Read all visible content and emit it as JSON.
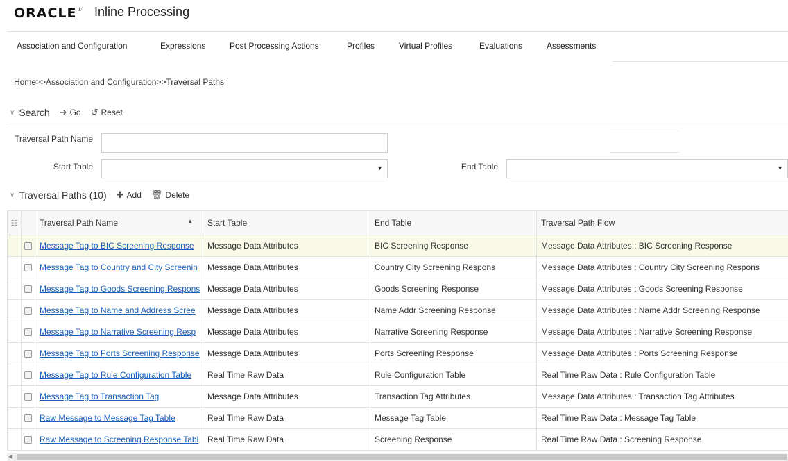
{
  "header": {
    "brand": "ORACLE",
    "brand_mark": "®",
    "app_title": "Inline Processing"
  },
  "tabs": [
    {
      "label": "Association and Configuration"
    },
    {
      "label": "Expressions"
    },
    {
      "label": "Post Processing Actions"
    },
    {
      "label": "Profiles"
    },
    {
      "label": "Virtual Profiles"
    },
    {
      "label": "Evaluations"
    },
    {
      "label": "Assessments"
    }
  ],
  "breadcrumb": "Home>>Association and Configuration>>Traversal Paths",
  "search": {
    "title": "Search",
    "go_label": "Go",
    "reset_label": "Reset",
    "fields": {
      "traversal_path_name_label": "Traversal Path Name",
      "traversal_path_name_value": "",
      "start_table_label": "Start Table",
      "start_table_value": "",
      "end_table_label": "End Table",
      "end_table_value": ""
    }
  },
  "grid": {
    "title": "Traversal Paths",
    "count": "(10)",
    "add_label": "Add",
    "delete_label": "Delete",
    "columns": [
      "Traversal Path Name",
      "Start Table",
      "End Table",
      "Traversal Path Flow"
    ],
    "rows": [
      [
        "Message Tag to BIC Screening Response",
        "Message Data Attributes",
        "BIC Screening Response",
        "Message Data Attributes : BIC Screening Response"
      ],
      [
        "Message Tag to Country and City Screenin",
        "Message Data Attributes",
        "Country City Screening Respons",
        "Message Data Attributes : Country City Screening Respons"
      ],
      [
        "Message Tag to Goods Screening Respons",
        "Message Data Attributes",
        "Goods Screening Response",
        "Message Data Attributes : Goods Screening Response"
      ],
      [
        "Message Tag to Name and Address Scree",
        "Message Data Attributes",
        "Name Addr Screening Response",
        "Message Data Attributes : Name Addr Screening Response"
      ],
      [
        "Message Tag to Narrative Screening Resp",
        "Message Data Attributes",
        "Narrative Screening Response",
        "Message Data Attributes : Narrative Screening Response"
      ],
      [
        "Message Tag to Ports Screening Response",
        "Message Data Attributes",
        "Ports Screening Response",
        "Message Data Attributes : Ports Screening Response"
      ],
      [
        "Message Tag to Rule Configuration Table",
        "Real Time Raw Data",
        "Rule Configuration Table",
        "Real Time Raw Data : Rule Configuration Table"
      ],
      [
        "Message Tag to Transaction Tag",
        "Message Data Attributes",
        "Transaction Tag Attributes",
        "Message Data Attributes : Transaction Tag Attributes"
      ],
      [
        "Raw Message to Message Tag Table",
        "Real Time Raw Data",
        "Message Tag Table",
        "Real Time Raw Data : Message Tag Table"
      ],
      [
        "Raw Message to Screening Response Tabl",
        "Real Time Raw Data",
        "Screening Response",
        "Real Time Raw Data : Screening Response"
      ]
    ]
  },
  "icons": {
    "collapse": "chevron-down-icon",
    "go": "arrow-right-icon",
    "reset": "refresh-icon",
    "add": "plus-icon",
    "delete": "trash-icon",
    "sort": "sort-asc-icon",
    "hierarchy": "hierarchy-icon",
    "dropdown": "caret-down-icon"
  },
  "colors": {
    "link": "#1a60b8",
    "selected_row": "#f9f9e8",
    "header_bg": "#f7f7f7"
  }
}
